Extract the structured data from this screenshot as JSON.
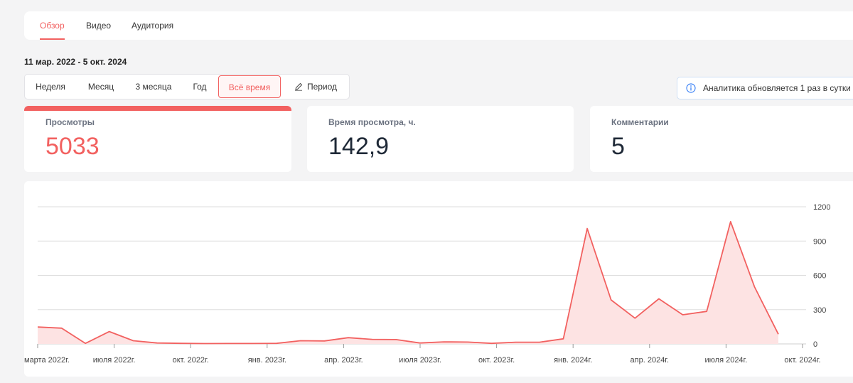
{
  "tabs": [
    {
      "label": "Обзор",
      "active": true
    },
    {
      "label": "Видео",
      "active": false
    },
    {
      "label": "Аудитория",
      "active": false
    }
  ],
  "date_range": "11 мар. 2022 - 5 окт. 2024",
  "periods": [
    {
      "label": "Неделя",
      "active": false
    },
    {
      "label": "Месяц",
      "active": false
    },
    {
      "label": "3 месяца",
      "active": false
    },
    {
      "label": "Год",
      "active": false
    },
    {
      "label": "Всё время",
      "active": true
    },
    {
      "label": "Период",
      "active": false,
      "icon": "pencil-icon"
    }
  ],
  "info": {
    "text": "Аналитика обновляется 1 раз в сутки",
    "icon": "info-icon"
  },
  "stats": [
    {
      "label": "Просмотры",
      "value": "5033",
      "active": true
    },
    {
      "label": "Время просмотра, ч.",
      "value": "142,9",
      "active": false
    },
    {
      "label": "Комментарии",
      "value": "5",
      "active": false
    }
  ],
  "colors": {
    "accent": "#f26160",
    "area_fill": "#fde3e3",
    "grid": "#dddddd"
  },
  "chart_data": {
    "type": "area",
    "series": [
      {
        "values": [
          148,
          138,
          5,
          108,
          28,
          8,
          5,
          3,
          4,
          4,
          5,
          28,
          26,
          55,
          40,
          38,
          8,
          18,
          16,
          5,
          15,
          15,
          45,
          1010,
          385,
          225,
          395,
          255,
          285,
          1070,
          500,
          85
        ]
      }
    ],
    "ylim": [
      0,
      1200
    ],
    "yticks": [
      "0",
      "300",
      "600",
      "900",
      "1200"
    ],
    "xtick_labels": [
      "марта 2022г.",
      "июля 2022г.",
      "окт. 2022г.",
      "янв. 2023г.",
      "апр. 2023г.",
      "июля 2023г.",
      "окт. 2023г.",
      "янв. 2024г.",
      "апр. 2024г.",
      "июля 2024г.",
      "окт. 2024г."
    ],
    "grid": true,
    "yaxis_position": "right"
  }
}
